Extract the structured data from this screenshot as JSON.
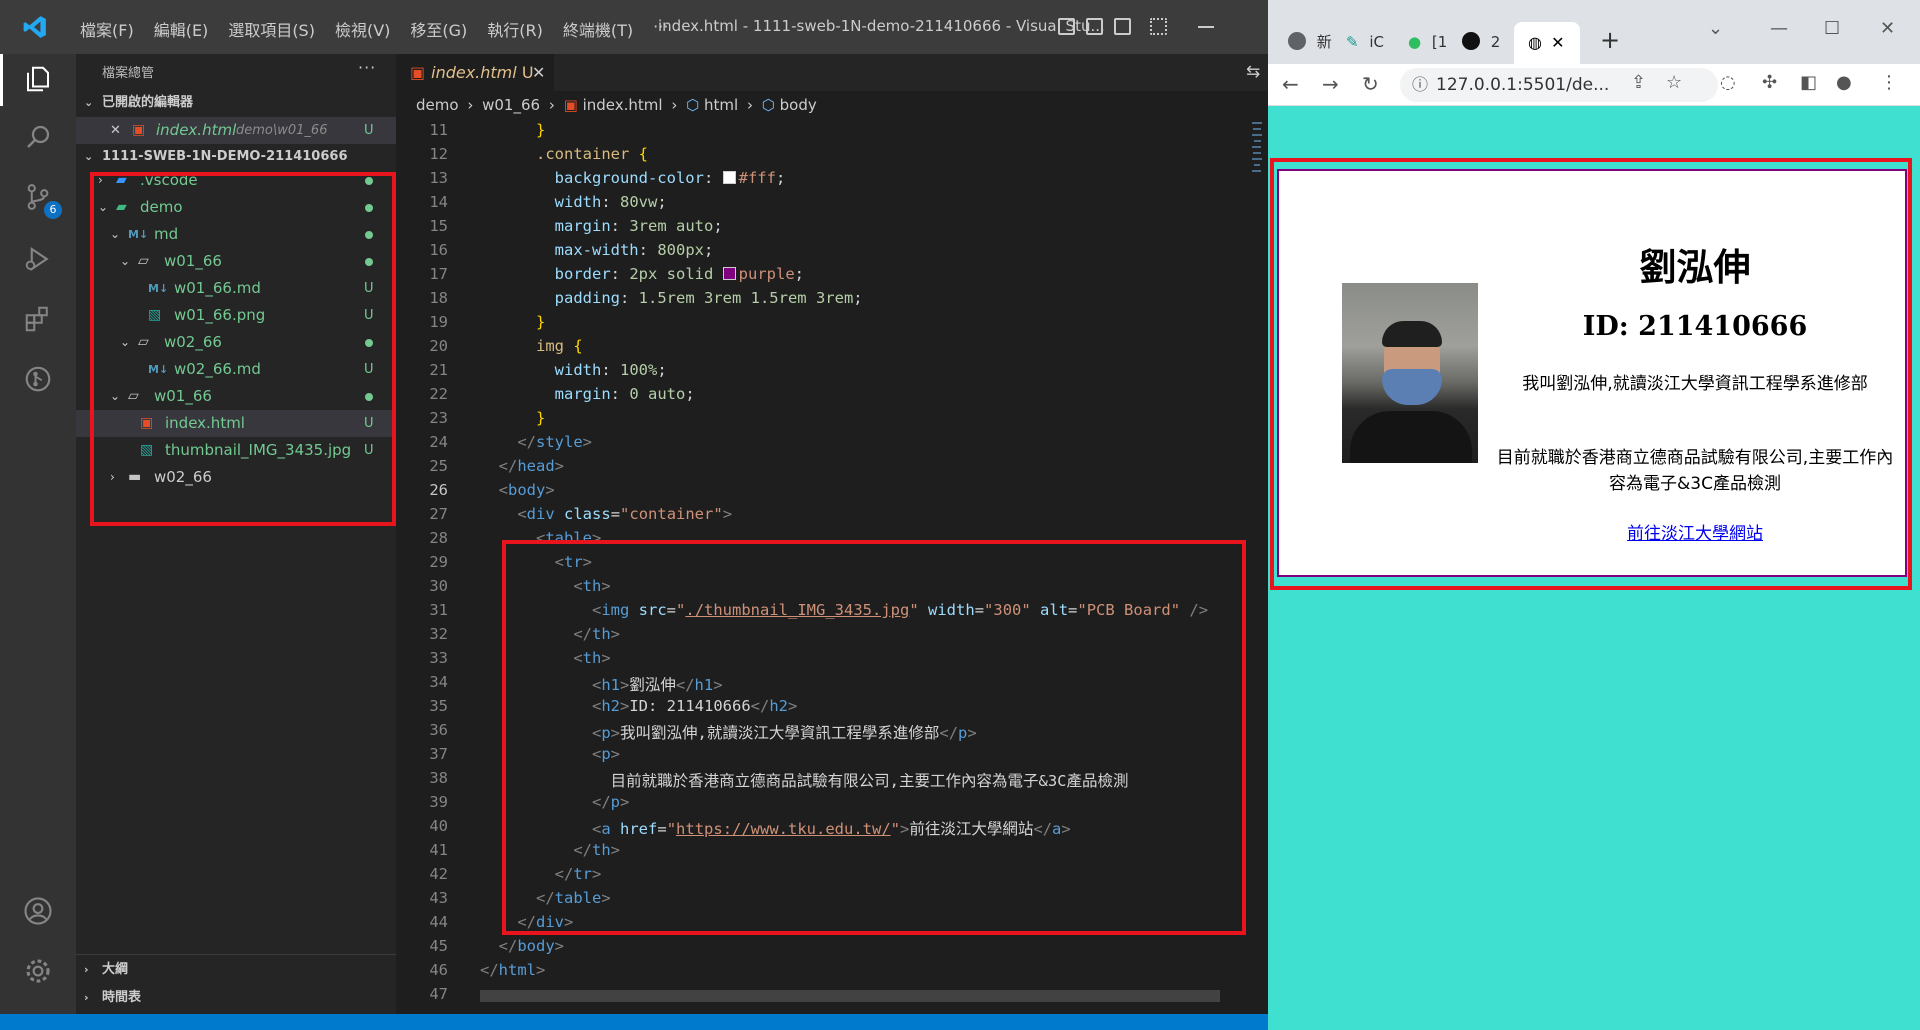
{
  "vscode": {
    "menu": [
      "檔案(F)",
      "編輯(E)",
      "選取項目(S)",
      "檢視(V)",
      "移至(G)",
      "執行(R)",
      "終端機(T)",
      "···"
    ],
    "window_title": "index.html - 1111-sweb-1N-demo-211410666 - Visual Stu...",
    "scm_badge": "6",
    "sidebar": {
      "title": "檔案總管",
      "more": "···",
      "open_editors_label": "已開啟的編輯器",
      "open_editor": {
        "name": "index.html",
        "path": "demo\\w01_66",
        "status": "U",
        "close": "✕"
      },
      "workspace_label": "1111-SWEB-1N-DEMO-211410666",
      "tree": [
        {
          "name": ".vscode",
          "kind": "folder-vscode",
          "twisty": "›",
          "status": "dot"
        },
        {
          "name": "demo",
          "kind": "folder-demo",
          "twisty": "⌄",
          "status": "dot"
        },
        {
          "name": "md",
          "kind": "folder-md",
          "twisty": "⌄",
          "status": "dot"
        },
        {
          "name": "w01_66",
          "kind": "folder-open",
          "twisty": "⌄",
          "status": "dot"
        },
        {
          "name": "w01_66.md",
          "kind": "markdown",
          "status": "U"
        },
        {
          "name": "w01_66.png",
          "kind": "image",
          "status": "U"
        },
        {
          "name": "w02_66",
          "kind": "folder-open",
          "twisty": "⌄",
          "status": "dot"
        },
        {
          "name": "w02_66.md",
          "kind": "markdown",
          "status": "U"
        },
        {
          "name": "w01_66",
          "kind": "folder-open",
          "twisty": "⌄",
          "status": "dot"
        },
        {
          "name": "index.html",
          "kind": "html",
          "status": "U"
        },
        {
          "name": "thumbnail_IMG_3435.jpg",
          "kind": "image",
          "status": "U"
        },
        {
          "name": "w02_66",
          "kind": "folder",
          "twisty": "›",
          "status": ""
        }
      ],
      "outline_label": "大綱",
      "timeline_label": "時間表"
    },
    "tab": {
      "label": "index.html",
      "status": "U",
      "close": "✕"
    },
    "breadcrumb": [
      "demo",
      "w01_66",
      "index.html",
      "html",
      "body"
    ],
    "code": {
      "line_numbers": [
        "11",
        "12",
        "13",
        "14",
        "15",
        "16",
        "17",
        "18",
        "19",
        "20",
        "21",
        "22",
        "23",
        "24",
        "25",
        "26",
        "27",
        "28",
        "29",
        "30",
        "31",
        "32",
        "33",
        "34",
        "35",
        "36",
        "37",
        "38",
        "39",
        "40",
        "41",
        "42",
        "43",
        "44",
        "45",
        "46",
        "47"
      ],
      "current_line": "26",
      "css_container": ".container",
      "css_bg_prop": "background-color",
      "css_bg_val": "#fff",
      "css_width_prop": "width",
      "css_width_val": "80vw",
      "css_margin_prop": "margin",
      "css_margin_val": "3rem auto",
      "css_maxw_prop": "max-width",
      "css_maxw_val": "800px",
      "css_border_prop": "border",
      "css_border_val": "2px solid",
      "css_border_color": "purple",
      "css_padding_prop": "padding",
      "css_padding_val": "1.5rem 3rem 1.5rem 3rem",
      "css_img": "img",
      "css_img_width_prop": "width",
      "css_img_width_val": "100%",
      "css_img_margin_prop": "margin",
      "css_img_margin_val": "0 auto",
      "img_src": "./thumbnail_IMG_3435.jpg",
      "img_width": "\"300\"",
      "img_alt": "\"PCB Board\"",
      "h1_text": "劉泓伸",
      "h2_text": "ID: 211410666",
      "p1_text": "我叫劉泓伸,就讀淡江大學資訊工程學系進修部",
      "p2_text": "目前就職於香港商立德商品試驗有限公司,主要工作內容為電子&3C產品檢測",
      "a_href": "https://www.tku.edu.tw/",
      "a_text": "前往淡江大學網站",
      "class_val": "\"container\""
    }
  },
  "browser": {
    "tabs": [
      {
        "label": "新",
        "icon": "chrome-icon"
      },
      {
        "label": "iC",
        "icon": "pen-icon"
      },
      {
        "label": "[1",
        "icon": "evernote-icon"
      },
      {
        "label": "2",
        "icon": "github-icon"
      }
    ],
    "active_tab_close": "✕",
    "new_tab": "+",
    "url": "127.0.0.1:5501/de...",
    "page": {
      "name": "劉泓伸",
      "id": "ID: 211410666",
      "intro": "我叫劉泓伸,就讀淡江大學資訊工程學系進修部",
      "job": "目前就職於香港商立德商品試驗有限公司,主要工作內容為電子&3C產品檢測",
      "link_text": "前往淡江大學網站",
      "img_alt": "PCB Board"
    }
  },
  "colors": {
    "page_bg": "#40e0d0",
    "highlight_box": "#e8141e",
    "card_border": "purple",
    "untracked": "#73c991"
  }
}
